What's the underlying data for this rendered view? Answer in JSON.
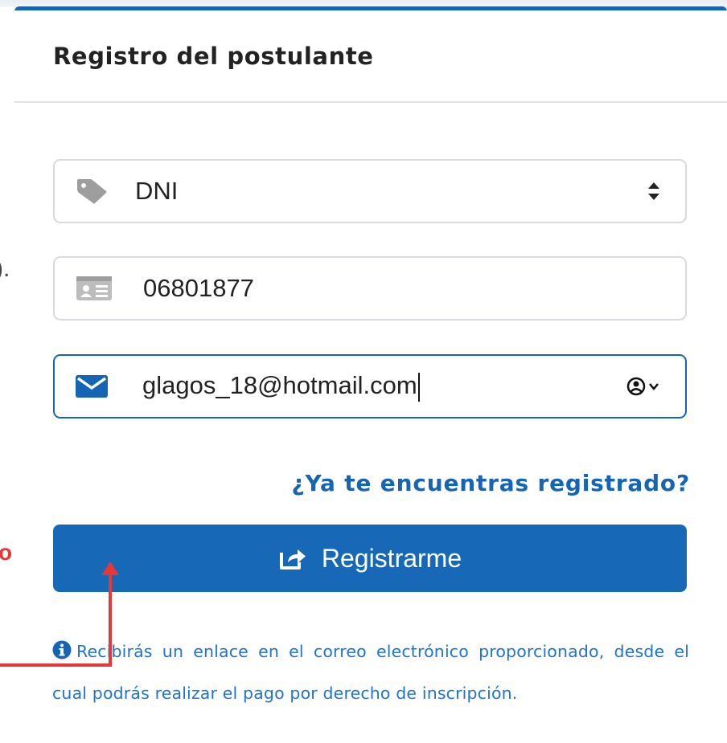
{
  "modal": {
    "title": "Registro del postulante"
  },
  "form": {
    "document_type": {
      "selected": "DNI",
      "icon": "tag-icon"
    },
    "document_number": {
      "value": "06801877",
      "icon": "id-card-icon"
    },
    "email": {
      "value": "glagos_18@hotmail.com",
      "icon": "envelope-icon",
      "autofill_icon": "user-circle-icon"
    },
    "already_registered_link": "¿Ya te encuentras registrado?",
    "submit_label": "Registrarme",
    "submit_icon": "share-square-icon",
    "info_message": "Recibirás un enlace en el correo electrónico proporcionado, desde el cual podrás realizar el pago por derecho de inscripción.",
    "info_icon": "info-circle-icon"
  },
  "annotation": {
    "left_fragment_top": ").",
    "left_fragment_bottom": "o",
    "arrow_color": "#e53935"
  },
  "colors": {
    "accent": "#1565b4",
    "info_text": "#1e74d2",
    "annotation": "#e53935"
  }
}
